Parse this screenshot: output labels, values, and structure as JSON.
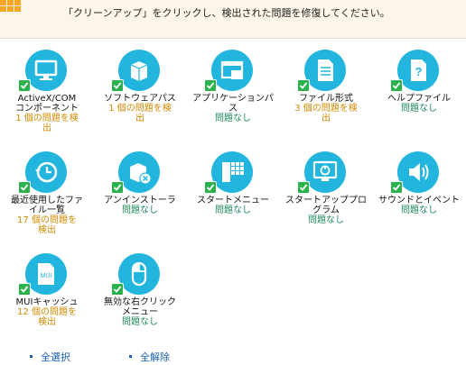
{
  "banner": {
    "instruction": "「クリーンアップ」をクリックし、検出された問題を修復してください。"
  },
  "tiles": [
    {
      "label": "ActiveX/COM\nコンポーネント",
      "status": "1 個の問題を検\n出",
      "state": "issue",
      "icon": "monitor-icon"
    },
    {
      "label": "ソフトウェアパス",
      "status": "1 個の問題を検\n出",
      "state": "issue",
      "icon": "package-box-icon"
    },
    {
      "label": "アプリケーションパ\nス",
      "status": "問題なし",
      "state": "ok",
      "icon": "application-window-icon"
    },
    {
      "label": "ファイル形式",
      "status": "3 個の問題を検\n出",
      "state": "issue",
      "icon": "document-icon"
    },
    {
      "label": "ヘルプファイル",
      "status": "問題なし",
      "state": "ok",
      "icon": "help-file-icon"
    },
    {
      "label": "最近使用したファ\nイル一覧",
      "status": "17 個の問題を\n検出",
      "state": "issue",
      "icon": "history-clock-icon"
    },
    {
      "label": "アンインストーラ",
      "status": "問題なし",
      "state": "ok",
      "icon": "uninstall-box-icon"
    },
    {
      "label": "スタートメニュー",
      "status": "問題なし",
      "state": "ok",
      "icon": "start-menu-icon"
    },
    {
      "label": "スタートアッププロ\nグラム",
      "status": "問題なし",
      "state": "ok",
      "icon": "startup-power-icon"
    },
    {
      "label": "サウンドとイベント",
      "status": "問題なし",
      "state": "ok",
      "icon": "speaker-icon"
    },
    {
      "label": "MUIキャッシュ",
      "status": "12 個の問題を\n検出",
      "state": "issue",
      "icon": "mui-file-icon"
    },
    {
      "label": "無効な右クリック\nメニュー",
      "status": "問題なし",
      "state": "ok",
      "icon": "mouse-icon"
    }
  ],
  "footer": {
    "select_all": "全選択",
    "deselect_all": "全解除"
  },
  "colors": {
    "accent": "#22b6de",
    "check": "#2bb24c",
    "issue": "#d18a00",
    "ok": "#1f8a5a",
    "link": "#1a5fb4"
  }
}
